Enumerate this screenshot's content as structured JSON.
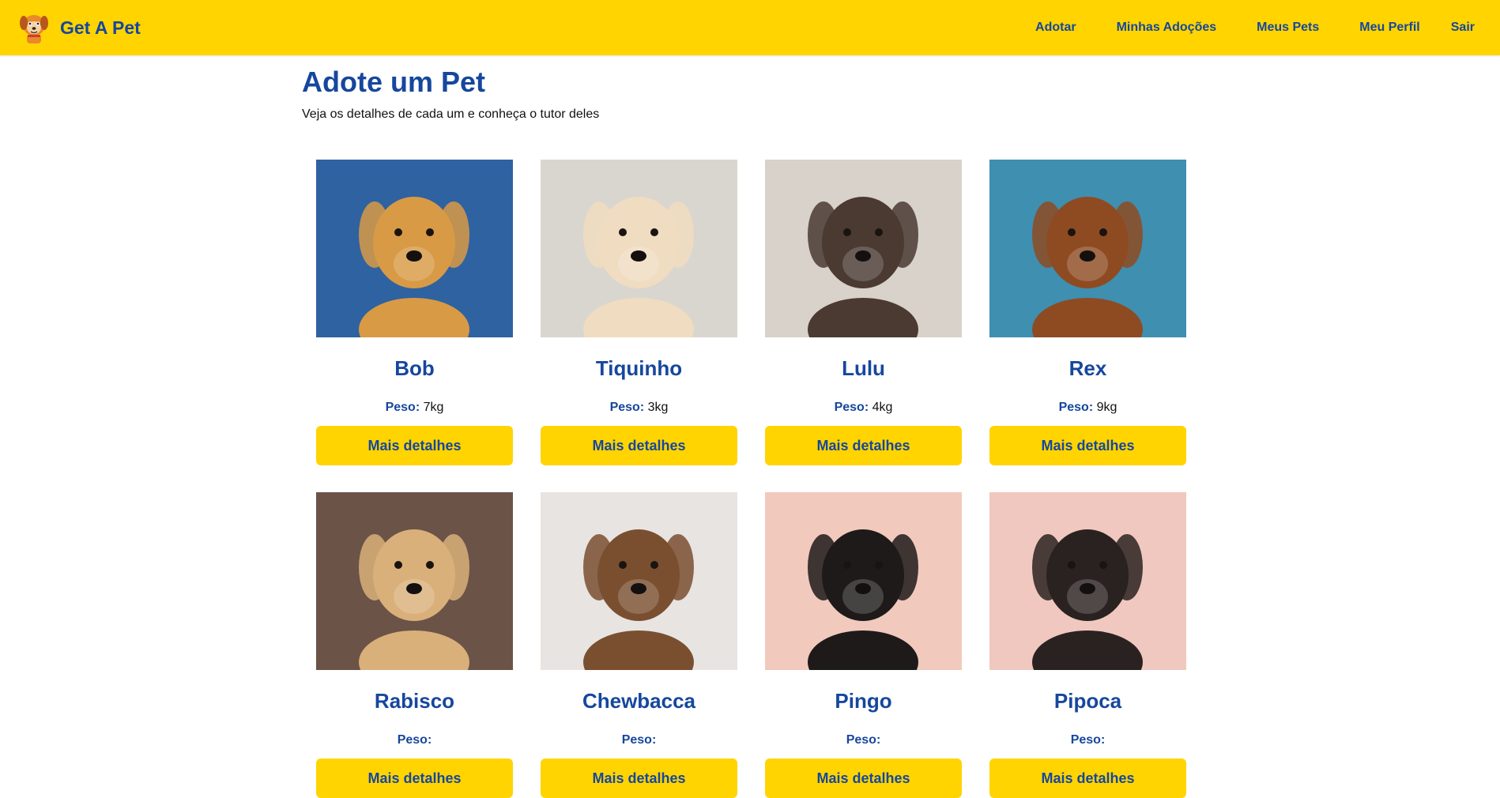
{
  "app": {
    "brand_name": "Get A Pet"
  },
  "nav": {
    "links": [
      "Adotar",
      "Minhas Adoções",
      "Meus Pets",
      "Meu Perfil",
      "Sair"
    ]
  },
  "page": {
    "title": "Adote um Pet",
    "subtitle": "Veja os detalhes de cada um e conheça o tutor deles"
  },
  "pets": [
    {
      "name": "Bob",
      "weight_label": "Peso:",
      "weight": "7kg",
      "button": "Mais detalhes",
      "photo_bg": "#2f62a0",
      "dog_color": "#d89a45"
    },
    {
      "name": "Tiquinho",
      "weight_label": "Peso:",
      "weight": "3kg",
      "button": "Mais detalhes",
      "photo_bg": "#d9d6d0",
      "dog_color": "#f0dcc0"
    },
    {
      "name": "Lulu",
      "weight_label": "Peso:",
      "weight": "4kg",
      "button": "Mais detalhes",
      "photo_bg": "#d8d2ca",
      "dog_color": "#4a3a32"
    },
    {
      "name": "Rex",
      "weight_label": "Peso:",
      "weight": "9kg",
      "button": "Mais detalhes",
      "photo_bg": "#3f8fb0",
      "dog_color": "#8e4b22"
    },
    {
      "name": "Rabisco",
      "weight_label": "Peso:",
      "weight": "",
      "button": "Mais detalhes",
      "photo_bg": "#6b5348",
      "dog_color": "#d9b07a"
    },
    {
      "name": "Chewbacca",
      "weight_label": "Peso:",
      "weight": "",
      "button": "Mais detalhes",
      "photo_bg": "#e8e4e2",
      "dog_color": "#7a4f30"
    },
    {
      "name": "Pingo",
      "weight_label": "Peso:",
      "weight": "",
      "button": "Mais detalhes",
      "photo_bg": "#f2c9bd",
      "dog_color": "#1e1a1a"
    },
    {
      "name": "Pipoca",
      "weight_label": "Peso:",
      "weight": "",
      "button": "Mais detalhes",
      "photo_bg": "#f0c8bf",
      "dog_color": "#2a2220"
    }
  ],
  "colors": {
    "accent": "#FFD400",
    "brand_blue": "#16479d"
  }
}
